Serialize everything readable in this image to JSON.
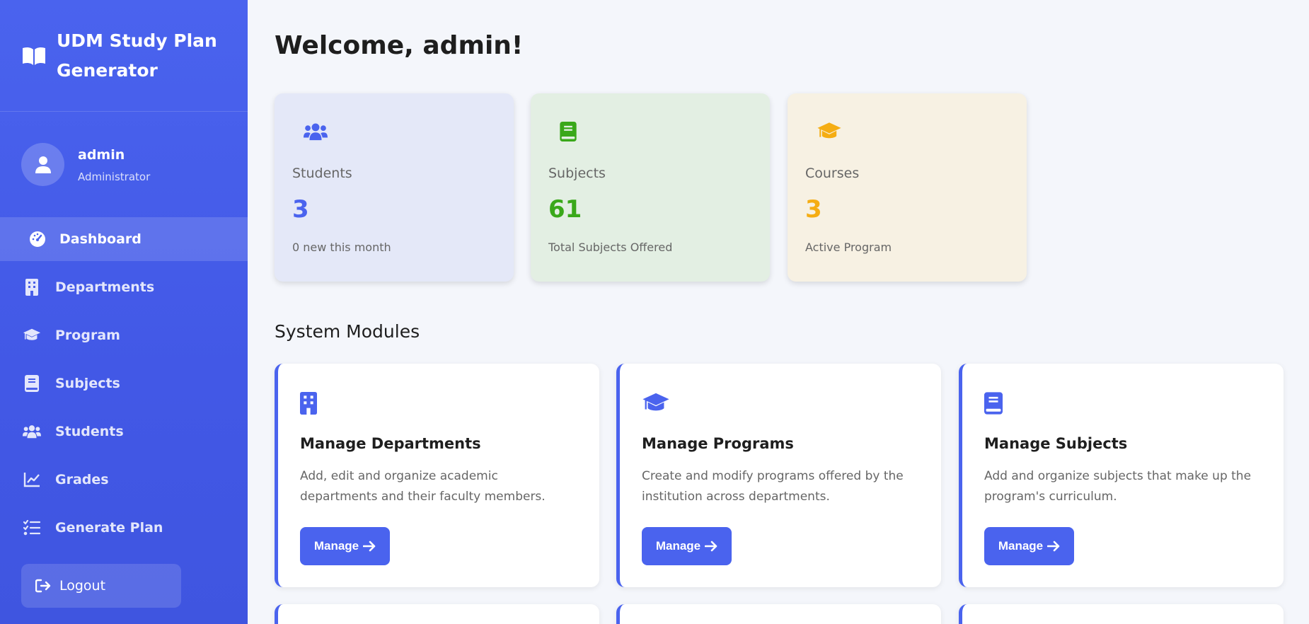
{
  "sidebar": {
    "brand_title": "UDM Study Plan Generator",
    "brand_icon": "book-open-icon",
    "user": {
      "name": "admin",
      "role": "Administrator",
      "avatar_icon": "user-icon"
    },
    "nav": [
      {
        "label": "Dashboard",
        "icon": "gauge-icon",
        "active": true
      },
      {
        "label": "Departments",
        "icon": "building-icon"
      },
      {
        "label": "Program",
        "icon": "graduation-cap-icon"
      },
      {
        "label": "Subjects",
        "icon": "book-icon"
      },
      {
        "label": "Students",
        "icon": "users-icon"
      },
      {
        "label": "Grades",
        "icon": "chart-line-icon"
      },
      {
        "label": "Generate Plan",
        "icon": "list-check-icon"
      }
    ],
    "logout_label": "Logout"
  },
  "main": {
    "welcome": "Welcome, admin!",
    "stats": [
      {
        "label": "Students",
        "value": "3",
        "sub": "0 new this month",
        "icon": "users-icon",
        "color": "#4a63ee",
        "bg": "#e4e8f8"
      },
      {
        "label": "Subjects",
        "value": "61",
        "sub": "Total Subjects Offered",
        "icon": "book-icon",
        "color": "#3aa81a",
        "bg": "#e3efe3"
      },
      {
        "label": "Courses",
        "value": "3",
        "sub": "Active Program",
        "icon": "graduation-cap-icon",
        "color": "#f5ad13",
        "bg": "#f7f1e3"
      }
    ],
    "modules_title": "System Modules",
    "modules": [
      {
        "title": "Manage Departments",
        "desc": "Add, edit and organize academic departments and their faculty members.",
        "button": "Manage",
        "icon": "building-icon"
      },
      {
        "title": "Manage Programs",
        "desc": "Create and modify programs offered by the institution across departments.",
        "button": "Manage",
        "icon": "graduation-cap-icon"
      },
      {
        "title": "Manage Subjects",
        "desc": "Add and organize subjects that make up the program's curriculum.",
        "button": "Manage",
        "icon": "book-icon"
      }
    ]
  },
  "colors": {
    "accent": "#4a63ee"
  }
}
